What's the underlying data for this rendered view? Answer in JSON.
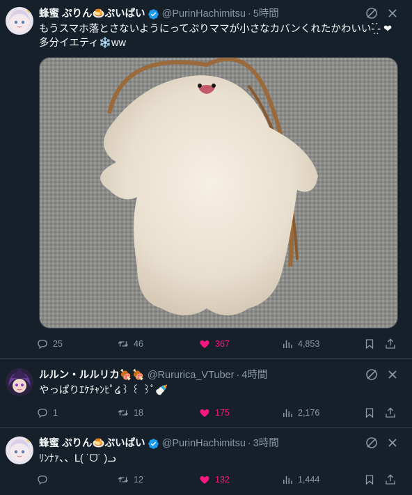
{
  "tweets": [
    {
      "author_name": "蜂蜜 ぷりん🍮ぷいぱい",
      "handle": "@PurinHachimitsu",
      "dot": "·",
      "time": "5時間",
      "text_line1": "もうスマホ落とさないようにってぷりママが小さなカバンくれたかわいい-̗̀ ̖́- ❤",
      "text_line2": "多分イエティ❄️ww",
      "stats": {
        "replies": "25",
        "retweets": "46",
        "likes": "367",
        "views": "4,853"
      }
    },
    {
      "author_name": "ルルン・ルルリカ🍖🍖",
      "handle": "@Rururica_VTuber",
      "dot": "·",
      "time": "4時間",
      "text_line1": "やっぱりｴｹﾁｬﾝﾋﾟ໒꒱ ꒰ ꒱ﾟ🍼",
      "stats": {
        "replies": "1",
        "retweets": "18",
        "likes": "175",
        "views": "2,176"
      }
    },
    {
      "author_name": "蜂蜜 ぷりん🍮ぷいぱい",
      "handle": "@PurinHachimitsu",
      "dot": "·",
      "time": "3時間",
      "text_line1": "ﾘﾝﾅｧ、、ᒪ( ˙ᗜ˙ )ᓗ",
      "stats": {
        "replies": "",
        "retweets": "12",
        "likes": "132",
        "views": "1,444"
      }
    }
  ],
  "colors": {
    "background": "#15202b",
    "text": "#f7f9f9",
    "secondary": "#8b98a5",
    "like": "#f91880",
    "verified": "#1d9bf0",
    "border": "#38444d"
  },
  "icons": [
    "verified-badge-icon",
    "grok-icon",
    "more-icon",
    "reply-icon",
    "retweet-icon",
    "heart-filled-icon",
    "views-icon",
    "bookmark-icon",
    "share-icon"
  ]
}
